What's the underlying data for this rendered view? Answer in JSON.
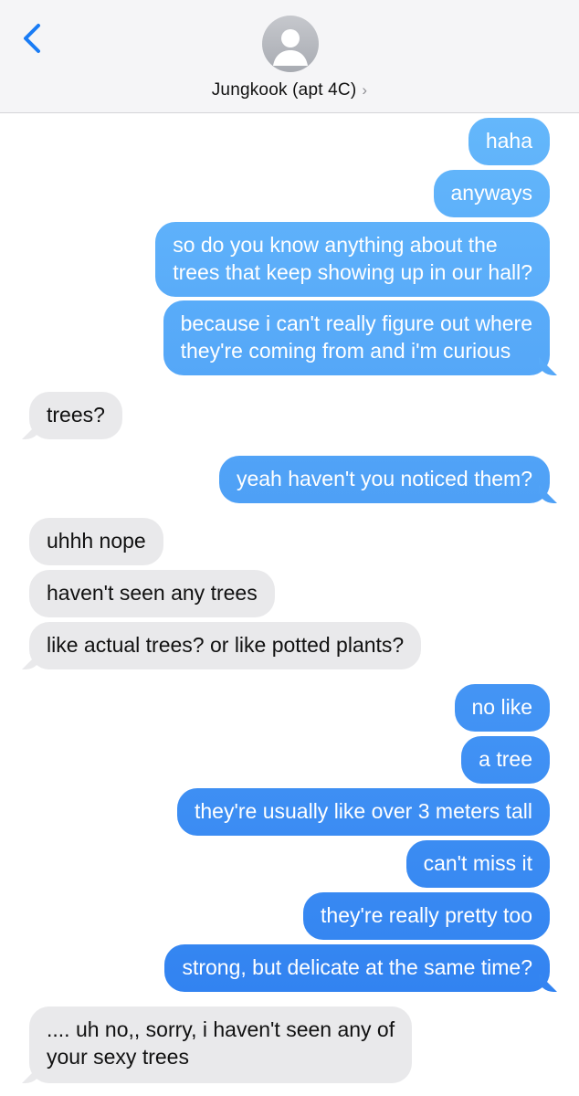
{
  "header": {
    "contact_name": "Jungkook (apt 4C)",
    "chevron": "›"
  },
  "messages": [
    {
      "from": "me",
      "text": "haha"
    },
    {
      "from": "me",
      "text": "anyways"
    },
    {
      "from": "me",
      "text": "so do you know anything about the\ntrees that keep showing up in our hall?"
    },
    {
      "from": "me",
      "text": "because i can't really figure out where\nthey're coming from and i'm curious"
    },
    {
      "from": "them",
      "text": "trees?"
    },
    {
      "from": "me",
      "text": "yeah haven't you noticed them?"
    },
    {
      "from": "them",
      "text": "uhhh nope"
    },
    {
      "from": "them",
      "text": "haven't seen any trees"
    },
    {
      "from": "them",
      "text": "like actual trees? or like potted plants?"
    },
    {
      "from": "me",
      "text": "no like"
    },
    {
      "from": "me",
      "text": "a tree"
    },
    {
      "from": "me",
      "text": "they're usually like over 3 meters tall"
    },
    {
      "from": "me",
      "text": "can't miss it"
    },
    {
      "from": "me",
      "text": "they're really pretty too"
    },
    {
      "from": "me",
      "text": "strong, but delicate at the same time?"
    },
    {
      "from": "them",
      "text": ".... uh no,, sorry, i haven't seen any of\nyour sexy trees"
    }
  ],
  "colors": {
    "outgoing_top": "#64b7fb",
    "outgoing_bottom": "#2f7ff0",
    "incoming": "#e9e9eb",
    "accent": "#1a7cf5"
  },
  "icons": {
    "back": "chevron-left-icon",
    "avatar": "person-icon"
  }
}
